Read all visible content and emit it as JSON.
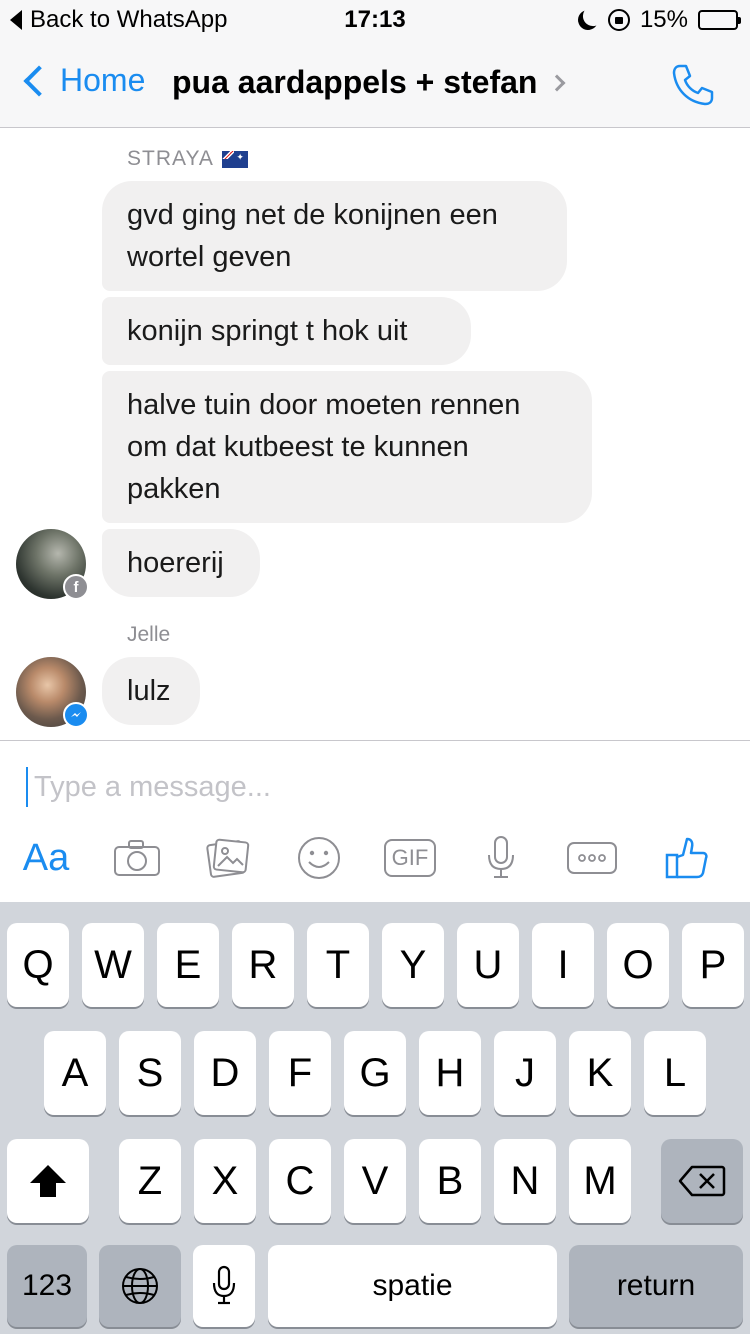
{
  "status_bar": {
    "back_label": "Back to WhatsApp",
    "time": "17:13",
    "battery_percent": "15%",
    "battery_level": 0.15,
    "battery_color": "#f5c518"
  },
  "nav": {
    "back_label": "Home",
    "title": "pua aardappels + stefan",
    "accent_color": "#1a8cf0"
  },
  "messages": {
    "group1_sender": "STRAYA",
    "m1": "gvd ging net de konijnen een wortel geven",
    "m2": "konijn springt t hok uit",
    "m3": "halve tuin door moeten rennen om dat kutbeest te kunnen pakken",
    "m4": "hoererij",
    "group2_sender": "Jelle",
    "m5": "lulz"
  },
  "compose": {
    "placeholder": "Type a message...",
    "aa_label": "Aa",
    "gif_label": "GIF"
  },
  "keyboard": {
    "row1": [
      "Q",
      "W",
      "E",
      "R",
      "T",
      "Y",
      "U",
      "I",
      "O",
      "P"
    ],
    "row2": [
      "A",
      "S",
      "D",
      "F",
      "G",
      "H",
      "J",
      "K",
      "L"
    ],
    "row3": [
      "Z",
      "X",
      "C",
      "V",
      "B",
      "N",
      "M"
    ],
    "numbers_label": "123",
    "space_label": "spatie",
    "return_label": "return"
  }
}
